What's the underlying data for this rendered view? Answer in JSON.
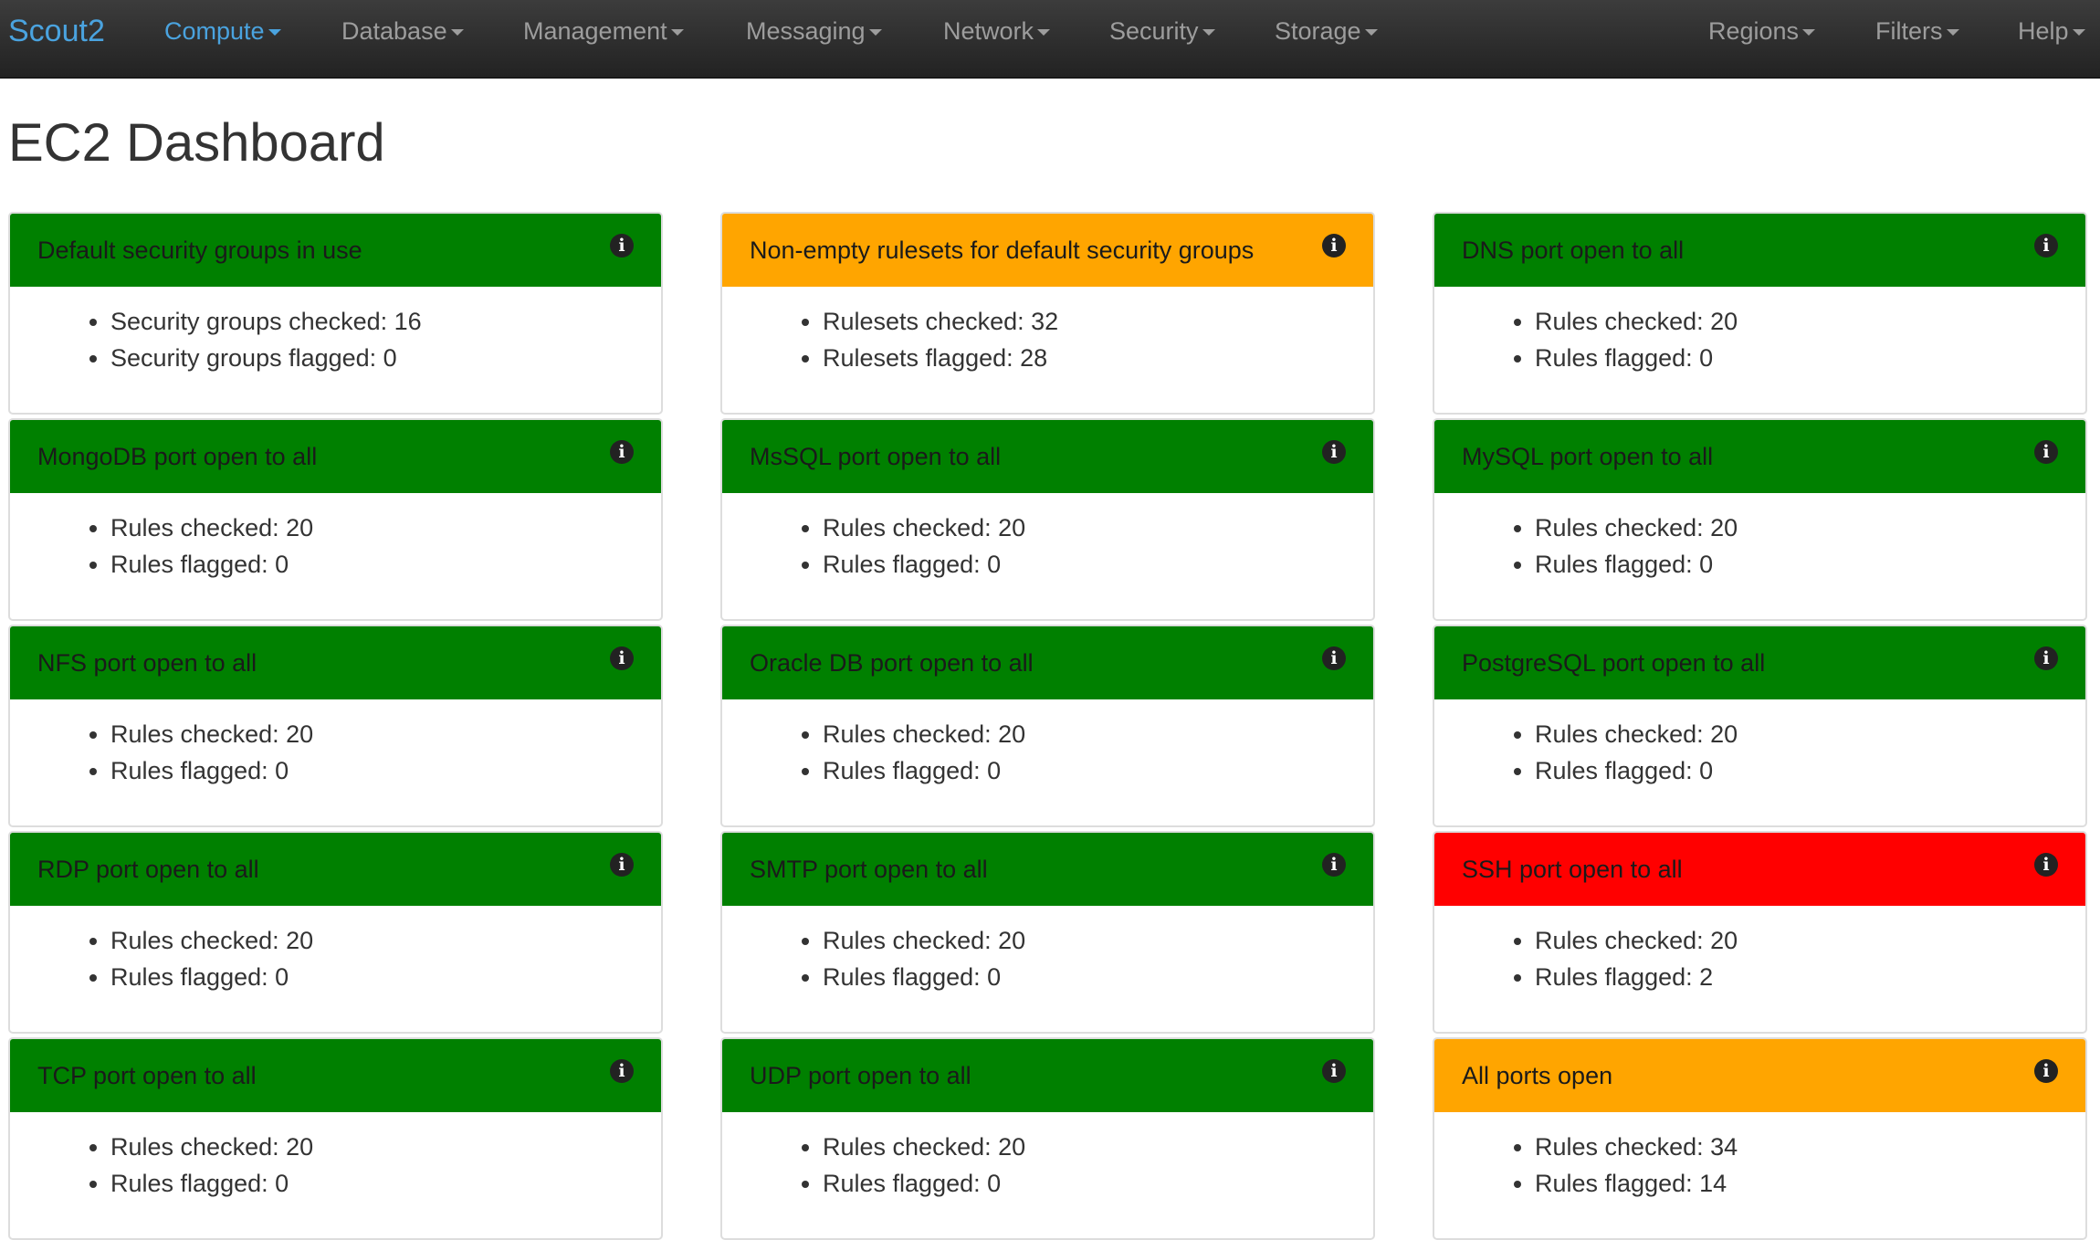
{
  "nav": {
    "brand": "Scout2",
    "menus": [
      "Compute",
      "Database",
      "Management",
      "Messaging",
      "Network",
      "Security",
      "Storage"
    ],
    "right_menus": [
      "Regions",
      "Filters",
      "Help"
    ],
    "active": "Compute"
  },
  "page": {
    "title": "EC2 Dashboard"
  },
  "colors": {
    "green": "#008000",
    "orange": "#ffa500",
    "red": "#ff0000",
    "brand": "#4aa3df"
  },
  "cards": [
    {
      "title": "Default security groups in use",
      "status": "green",
      "checked_label": "Security groups checked: 16",
      "flagged_label": "Security groups flagged: 0",
      "checked": 16,
      "flagged": 0
    },
    {
      "title": "Non-empty rulesets for default security groups",
      "status": "orange",
      "checked_label": "Rulesets checked: 32",
      "flagged_label": "Rulesets flagged: 28",
      "checked": 32,
      "flagged": 28
    },
    {
      "title": "DNS port open to all",
      "status": "green",
      "checked_label": "Rules checked: 20",
      "flagged_label": "Rules flagged: 0",
      "checked": 20,
      "flagged": 0
    },
    {
      "title": "MongoDB port open to all",
      "status": "green",
      "checked_label": "Rules checked: 20",
      "flagged_label": "Rules flagged: 0",
      "checked": 20,
      "flagged": 0
    },
    {
      "title": "MsSQL port open to all",
      "status": "green",
      "checked_label": "Rules checked: 20",
      "flagged_label": "Rules flagged: 0",
      "checked": 20,
      "flagged": 0
    },
    {
      "title": "MySQL port open to all",
      "status": "green",
      "checked_label": "Rules checked: 20",
      "flagged_label": "Rules flagged: 0",
      "checked": 20,
      "flagged": 0
    },
    {
      "title": "NFS port open to all",
      "status": "green",
      "checked_label": "Rules checked: 20",
      "flagged_label": "Rules flagged: 0",
      "checked": 20,
      "flagged": 0
    },
    {
      "title": "Oracle DB port open to all",
      "status": "green",
      "checked_label": "Rules checked: 20",
      "flagged_label": "Rules flagged: 0",
      "checked": 20,
      "flagged": 0
    },
    {
      "title": "PostgreSQL port open to all",
      "status": "green",
      "checked_label": "Rules checked: 20",
      "flagged_label": "Rules flagged: 0",
      "checked": 20,
      "flagged": 0
    },
    {
      "title": "RDP port open to all",
      "status": "green",
      "checked_label": "Rules checked: 20",
      "flagged_label": "Rules flagged: 0",
      "checked": 20,
      "flagged": 0
    },
    {
      "title": "SMTP port open to all",
      "status": "green",
      "checked_label": "Rules checked: 20",
      "flagged_label": "Rules flagged: 0",
      "checked": 20,
      "flagged": 0
    },
    {
      "title": "SSH port open to all",
      "status": "red",
      "checked_label": "Rules checked: 20",
      "flagged_label": "Rules flagged: 2",
      "checked": 20,
      "flagged": 2
    },
    {
      "title": "TCP port open to all",
      "status": "green",
      "checked_label": "Rules checked: 20",
      "flagged_label": "Rules flagged: 0",
      "checked": 20,
      "flagged": 0
    },
    {
      "title": "UDP port open to all",
      "status": "green",
      "checked_label": "Rules checked: 20",
      "flagged_label": "Rules flagged: 0",
      "checked": 20,
      "flagged": 0
    },
    {
      "title": "All ports open",
      "status": "orange",
      "checked_label": "Rules checked: 34",
      "flagged_label": "Rules flagged: 14",
      "checked": 34,
      "flagged": 14
    }
  ]
}
